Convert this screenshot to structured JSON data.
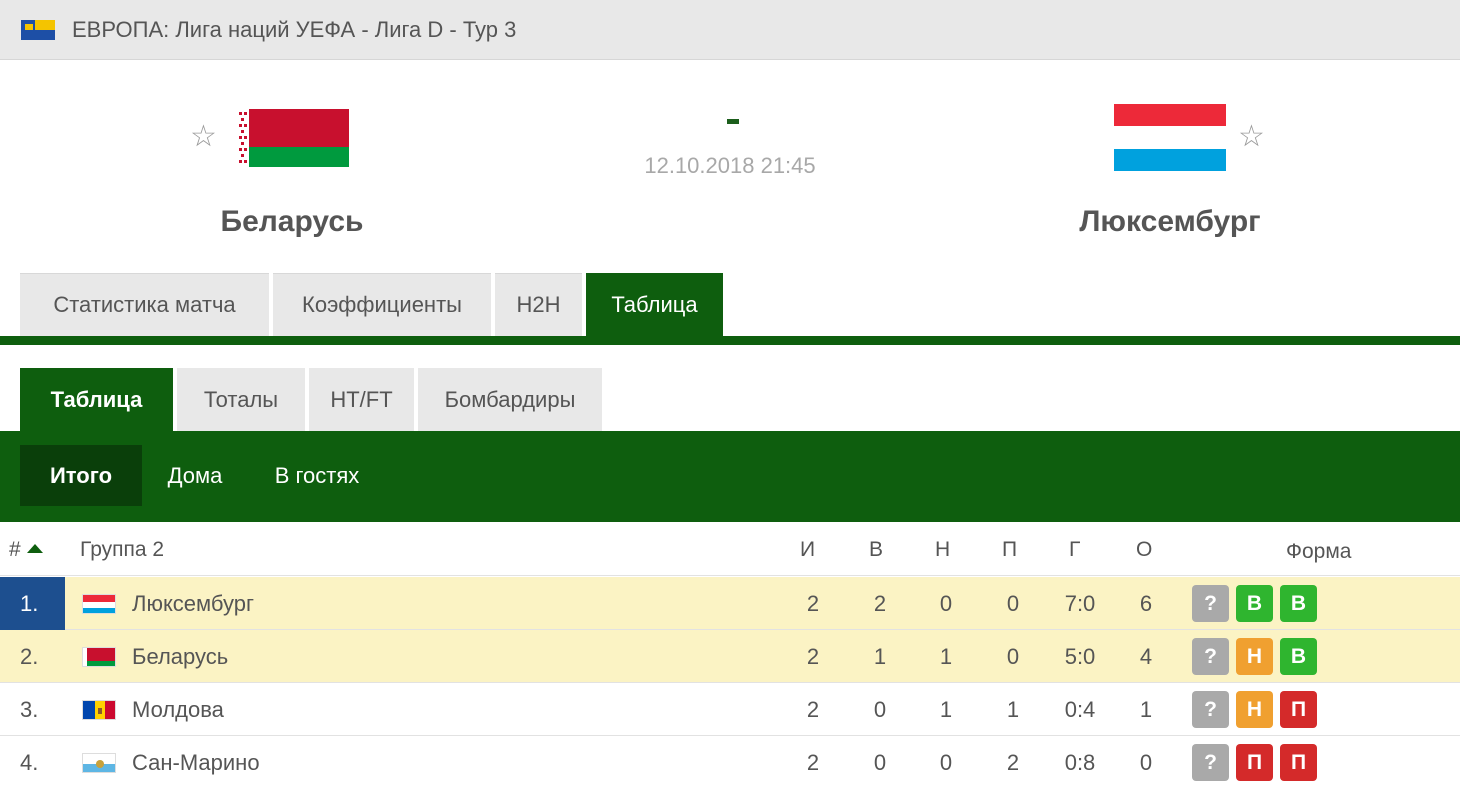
{
  "league": {
    "title": "ЕВРОПА: Лига наций УЕФА - Лига D - Тур 3"
  },
  "match": {
    "home": {
      "name": "Беларусь"
    },
    "away": {
      "name": "Люксембург"
    },
    "score": "-",
    "date": "12.10.2018 21:45"
  },
  "main_tabs": [
    {
      "label": "Статистика матча"
    },
    {
      "label": "Коэффициенты"
    },
    {
      "label": "H2H"
    },
    {
      "label": "Таблица",
      "active": true
    }
  ],
  "sub_tabs": [
    {
      "label": "Таблица",
      "active": true
    },
    {
      "label": "Тоталы"
    },
    {
      "label": "HT/FT"
    },
    {
      "label": "Бомбардиры"
    }
  ],
  "filters": [
    {
      "label": "Итого",
      "active": true
    },
    {
      "label": "Дома"
    },
    {
      "label": "В гостях"
    }
  ],
  "table": {
    "headers": {
      "rank": "#",
      "group": "Группа 2",
      "played": "И",
      "won": "В",
      "draw": "Н",
      "lost": "П",
      "goals": "Г",
      "points": "О",
      "form": "Форма"
    },
    "rows": [
      {
        "rank": "1.",
        "team": "Люксембург",
        "played": "2",
        "won": "2",
        "draw": "0",
        "lost": "0",
        "goals": "7:0",
        "points": "6",
        "form": [
          "?",
          "В",
          "В"
        ]
      },
      {
        "rank": "2.",
        "team": "Беларусь",
        "played": "2",
        "won": "1",
        "draw": "1",
        "lost": "0",
        "goals": "5:0",
        "points": "4",
        "form": [
          "?",
          "Н",
          "В"
        ]
      },
      {
        "rank": "3.",
        "team": "Молдова",
        "played": "2",
        "won": "0",
        "draw": "1",
        "lost": "1",
        "goals": "0:4",
        "points": "1",
        "form": [
          "?",
          "Н",
          "П"
        ]
      },
      {
        "rank": "4.",
        "team": "Сан-Марино",
        "played": "2",
        "won": "0",
        "draw": "0",
        "lost": "2",
        "goals": "0:8",
        "points": "0",
        "form": [
          "?",
          "П",
          "П"
        ]
      }
    ]
  },
  "icons": {
    "favorite": "star-outline-icon",
    "sort": "sort-ascending-icon",
    "star_glyph": "☆"
  },
  "colors": {
    "primary_green": "#0e5e0e",
    "leader_blue": "#1d4f8f",
    "highlight_row": "#fbf3c4",
    "form_win": "#2fb52f",
    "form_draw": "#f0a030",
    "form_loss": "#d42a2a",
    "form_unknown": "#a9a9a9"
  }
}
